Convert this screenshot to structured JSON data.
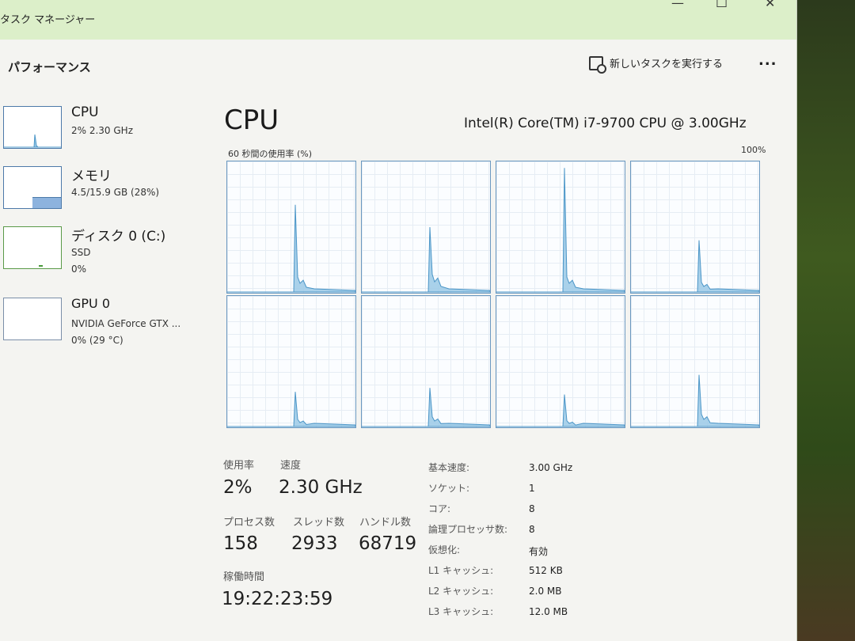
{
  "window": {
    "title": "タスク マネージャー"
  },
  "toolbar": {
    "heading": "パフォーマンス",
    "run_task_label": "新しいタスクを実行する",
    "more_label": "..."
  },
  "sidebar": {
    "items": [
      {
        "title": "CPU",
        "line1": "2% 2.30 GHz",
        "line2": ""
      },
      {
        "title": "メモリ",
        "line1": "4.5/15.9 GB (28%)",
        "line2": ""
      },
      {
        "title": "ディスク 0 (C:)",
        "line1": "SSD",
        "line2": "0%"
      },
      {
        "title": "GPU 0",
        "line1": "NVIDIA GeForce GTX ...",
        "line2": "0% (29 °C)"
      }
    ]
  },
  "main": {
    "title": "CPU",
    "model": "Intel(R) Core(TM) i7-9700 CPU @ 3.00GHz",
    "graph_caption": "60 秒間の使用率 (%)",
    "graph_max": "100%"
  },
  "cores": [
    {
      "peak": 0.67,
      "tail": 0.12
    },
    {
      "peak": 0.5,
      "tail": 0.14
    },
    {
      "peak": 0.95,
      "tail": 0.12
    },
    {
      "peak": 0.4,
      "tail": 0.08
    },
    {
      "peak": 0.27,
      "tail": 0.06
    },
    {
      "peak": 0.3,
      "tail": 0.08
    },
    {
      "peak": 0.25,
      "tail": 0.05
    },
    {
      "peak": 0.4,
      "tail": 0.1
    }
  ],
  "stats": {
    "usage_label": "使用率",
    "usage": "2%",
    "speed_label": "速度",
    "speed": "2.30 GHz",
    "processes_label": "プロセス数",
    "processes": "158",
    "threads_label": "スレッド数",
    "threads": "2933",
    "handles_label": "ハンドル数",
    "handles": "68719",
    "uptime_label": "稼働時間",
    "uptime": "19:22:23:59"
  },
  "specs": [
    {
      "label": "基本速度:",
      "value": "3.00 GHz"
    },
    {
      "label": "ソケット:",
      "value": "1"
    },
    {
      "label": "コア:",
      "value": "8"
    },
    {
      "label": "論理プロセッサ数:",
      "value": "8"
    },
    {
      "label": "仮想化:",
      "value": "有効"
    },
    {
      "label": "L1 キャッシュ:",
      "value": "512 KB"
    },
    {
      "label": "L2 キャッシュ:",
      "value": "2.0 MB"
    },
    {
      "label": "L3 キャッシュ:",
      "value": "12.0 MB"
    }
  ],
  "colors": {
    "graph_line": "#4a95c7",
    "graph_fill": "#9ac9e6",
    "memory_fill": "#8db3de",
    "disk_line": "#4a9a3c"
  }
}
